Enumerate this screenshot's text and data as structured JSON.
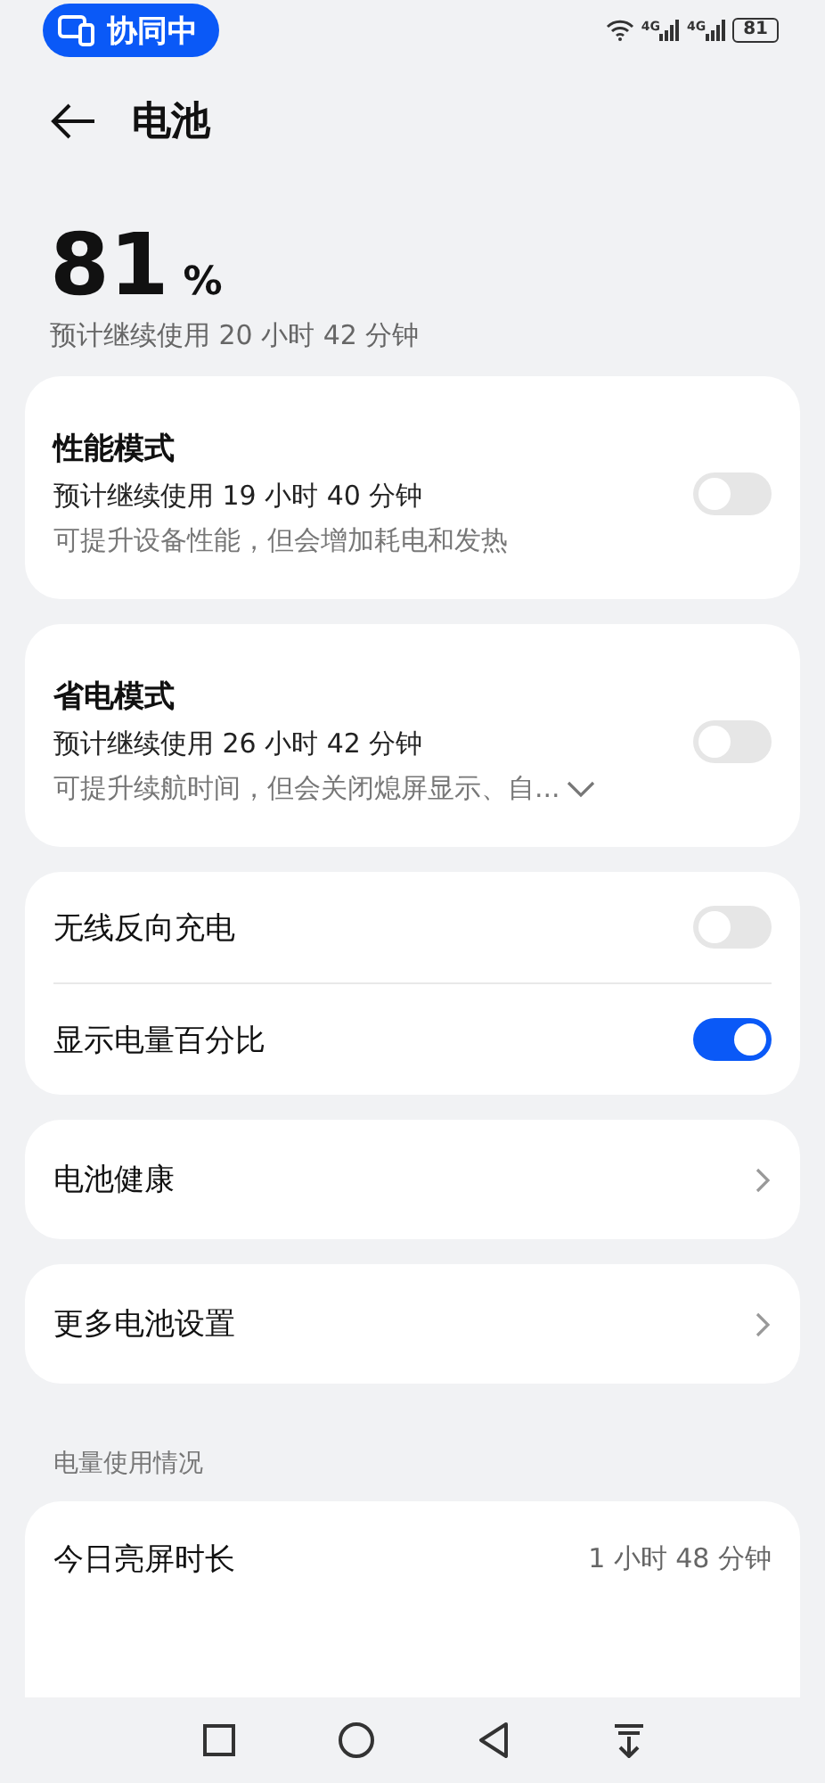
{
  "status_bar": {
    "badge": "协同中",
    "network": [
      "4G",
      "4G"
    ],
    "battery": "81"
  },
  "header": {
    "title": "电池"
  },
  "summary": {
    "percent": "81",
    "unit": "%",
    "estimate": "预计继续使用 20 小时 42 分钟"
  },
  "mode_cards": [
    {
      "title": "性能模式",
      "estimate": "预计继续使用 19 小时 40 分钟",
      "description": "可提升设备性能，但会增加耗电和发热",
      "on": false,
      "expandable": false
    },
    {
      "title": "省电模式",
      "estimate": "预计继续使用 26 小时 42 分钟",
      "description": "可提升续航时间，但会关闭熄屏显示、自...",
      "on": false,
      "expandable": true
    }
  ],
  "toggle_rows": [
    {
      "label": "无线反向充电",
      "on": false
    },
    {
      "label": "显示电量百分比",
      "on": true
    }
  ],
  "link_cards": [
    {
      "label": "电池健康"
    },
    {
      "label": "更多电池设置"
    }
  ],
  "usage": {
    "heading": "电量使用情况",
    "rows": [
      {
        "kind": "value",
        "label": "今日亮屏时长",
        "value": "1 小时 48 分钟"
      }
    ]
  }
}
